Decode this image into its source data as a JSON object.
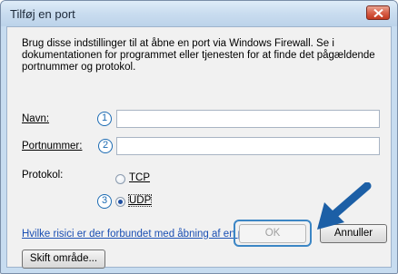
{
  "window": {
    "title": "Tilføj en port"
  },
  "description": "Brug disse indstillinger til at åbne en port via Windows Firewall. Se i dokumentationen for programmet eller tjenesten for at finde det pågældende portnummer og protokol.",
  "fields": {
    "name_label": "Navn:",
    "name_value": "",
    "port_label": "Portnummer:",
    "port_value": ""
  },
  "protocol": {
    "label": "Protokol:",
    "options": [
      {
        "label": "TCP",
        "selected": false
      },
      {
        "label": "UDP",
        "selected": true
      }
    ]
  },
  "steps": [
    "1",
    "2",
    "3"
  ],
  "help_link": "Hvilke risici er der forbundet med åbning af en port?",
  "buttons": {
    "scope": "Skift område...",
    "ok": "OK",
    "cancel": "Annuller"
  },
  "colors": {
    "accent": "#1c6bb3",
    "link": "#1a4fb3",
    "close": "#c2381f"
  }
}
